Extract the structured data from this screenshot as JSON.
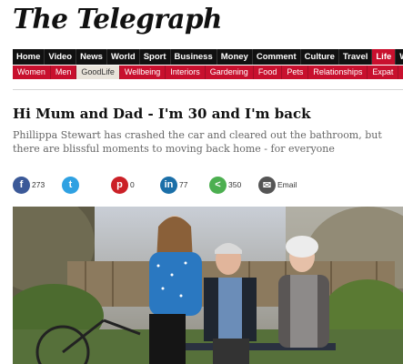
{
  "masthead": {
    "title": "The Telegraph"
  },
  "primary_nav": [
    {
      "label": "Home"
    },
    {
      "label": "Video"
    },
    {
      "label": "News"
    },
    {
      "label": "World"
    },
    {
      "label": "Sport"
    },
    {
      "label": "Business"
    },
    {
      "label": "Money"
    },
    {
      "label": "Comment"
    },
    {
      "label": "Culture"
    },
    {
      "label": "Travel"
    },
    {
      "label": "Life",
      "active": true
    },
    {
      "label": "Wo"
    }
  ],
  "secondary_nav": [
    {
      "label": "Women"
    },
    {
      "label": "Men"
    },
    {
      "label": "GoodLife",
      "active": true
    },
    {
      "label": "Wellbeing"
    },
    {
      "label": "Interiors"
    },
    {
      "label": "Gardening"
    },
    {
      "label": "Food"
    },
    {
      "label": "Pets"
    },
    {
      "label": "Relationships"
    },
    {
      "label": "Expat"
    }
  ],
  "article": {
    "headline": "Hi Mum and Dad - I'm 30 and I'm back",
    "standfirst": "Phillippa Stewart has crashed the car and cleared out the bathroom, but there are blissful moments to moving back home - for everyone"
  },
  "share": [
    {
      "name": "facebook",
      "icon": "facebook-icon",
      "glyph": "f",
      "count": "273",
      "color": "#3b5998"
    },
    {
      "name": "twitter",
      "icon": "twitter-icon",
      "glyph": "t",
      "count": "",
      "color": "#2fa1e2"
    },
    {
      "name": "pinterest",
      "icon": "pinterest-icon",
      "glyph": "p",
      "count": "0",
      "color": "#cb2027"
    },
    {
      "name": "linkedin",
      "icon": "linkedin-icon",
      "glyph": "in",
      "count": "77",
      "color": "#1b6fa8"
    },
    {
      "name": "share",
      "icon": "share-icon",
      "glyph": "<",
      "count": "350",
      "color": "#4caf50"
    },
    {
      "name": "email",
      "icon": "email-icon",
      "glyph": "✉",
      "count": "Email",
      "color": "#555"
    }
  ]
}
